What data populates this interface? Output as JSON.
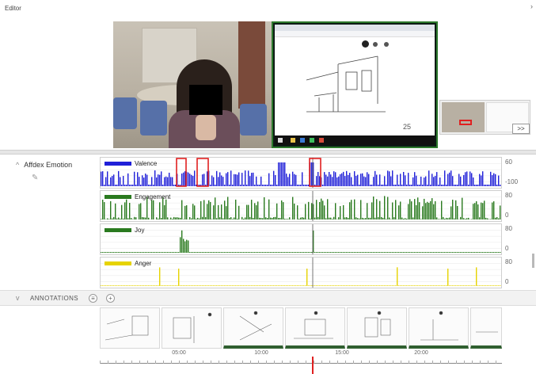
{
  "window": {
    "title": "Editor",
    "close_label": "›"
  },
  "video": {
    "page_number": "25",
    "next_label": ">>"
  },
  "emotion_panel": {
    "title": "Affdex Emotion",
    "rows": [
      {
        "key": "valence",
        "label": "Valence",
        "color": "#1f1fd8",
        "y_top": "60",
        "y_bottom": "-100"
      },
      {
        "key": "engagement",
        "label": "Engagement",
        "color": "#2a7a1f",
        "y_top": "80",
        "y_bottom": "0"
      },
      {
        "key": "joy",
        "label": "Joy",
        "color": "#2a7a1f",
        "y_top": "80",
        "y_bottom": "0"
      },
      {
        "key": "anger",
        "label": "Anger",
        "color": "#e6d300",
        "y_top": "80",
        "y_bottom": "0"
      }
    ],
    "highlight_color": "#e02020"
  },
  "annotations": {
    "label": "ANNOTATIONS"
  },
  "timeline": {
    "ticks": [
      "05:00",
      "10:00",
      "15:00",
      "20:00"
    ],
    "playhead_color": "#e02020"
  }
}
